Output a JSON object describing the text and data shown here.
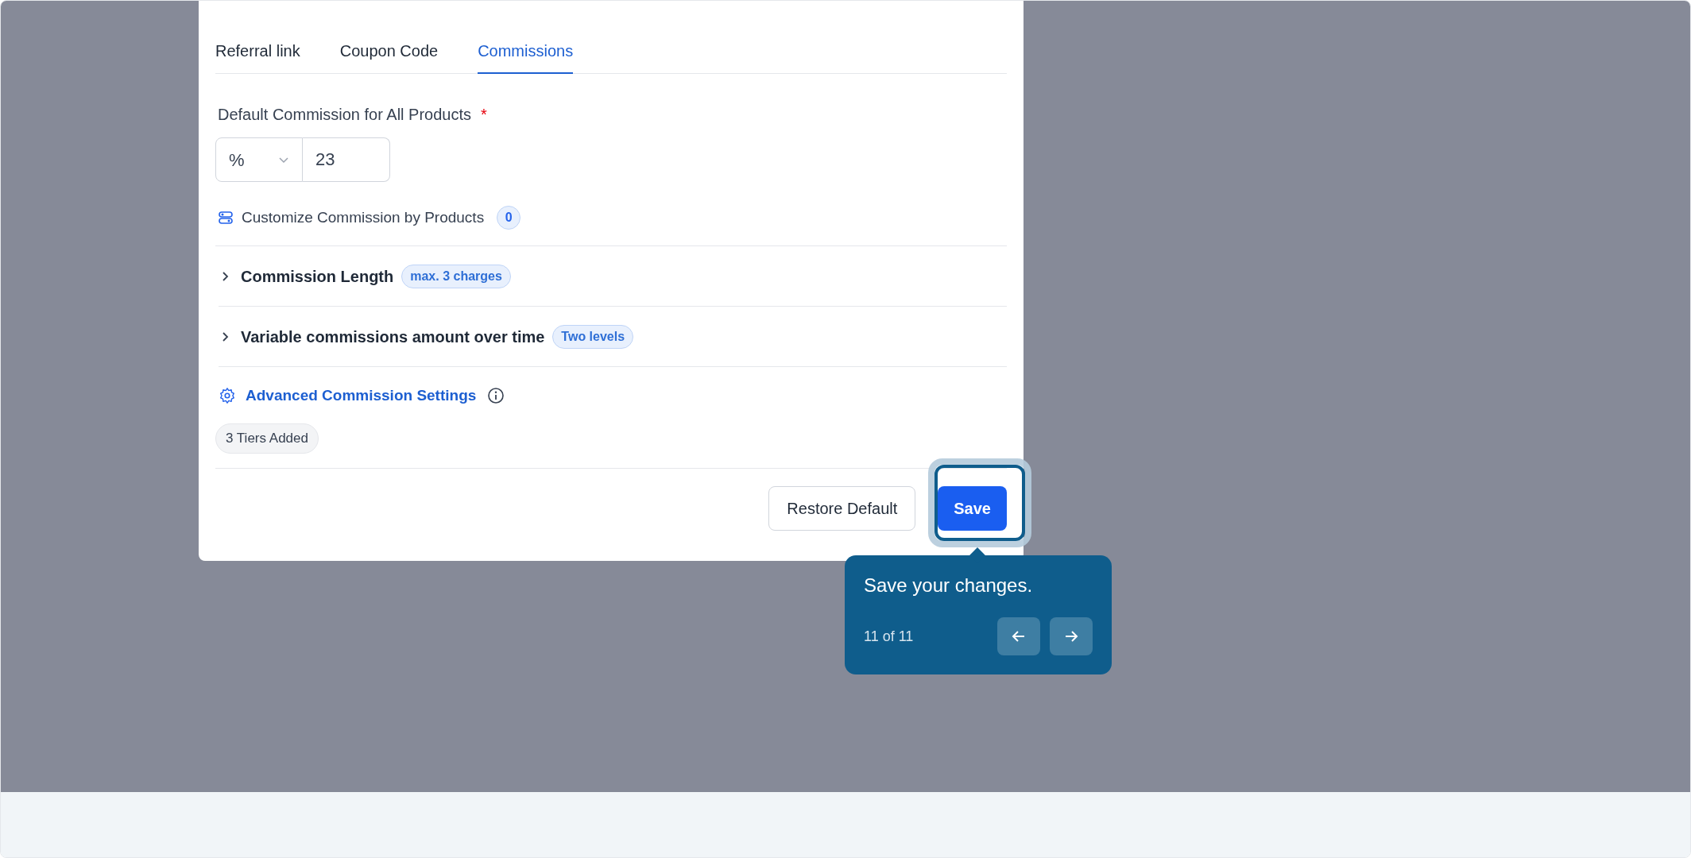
{
  "tabs": [
    {
      "label": "Referral link",
      "selected": false
    },
    {
      "label": "Coupon Code",
      "selected": false
    },
    {
      "label": "Commissions",
      "selected": true
    }
  ],
  "default_commission": {
    "label": "Default Commission for All Products",
    "required_mark": "*",
    "unit": "%",
    "value": "23"
  },
  "customize": {
    "label": "Customize Commission by Products",
    "count": "0"
  },
  "sections": [
    {
      "title": "Commission Length",
      "badge": "max. 3 charges",
      "expanded": false
    },
    {
      "title": "Variable commissions amount over time",
      "badge": "Two levels",
      "expanded": false
    }
  ],
  "advanced": {
    "label": "Advanced Commission Settings",
    "badge": "3 Tiers Added"
  },
  "buttons": [
    {
      "label": "Restore Default",
      "kind": "secondary"
    },
    {
      "label": "Save",
      "kind": "primary"
    }
  ],
  "tour": {
    "message": "Save your changes.",
    "progress": "11 of 11"
  }
}
